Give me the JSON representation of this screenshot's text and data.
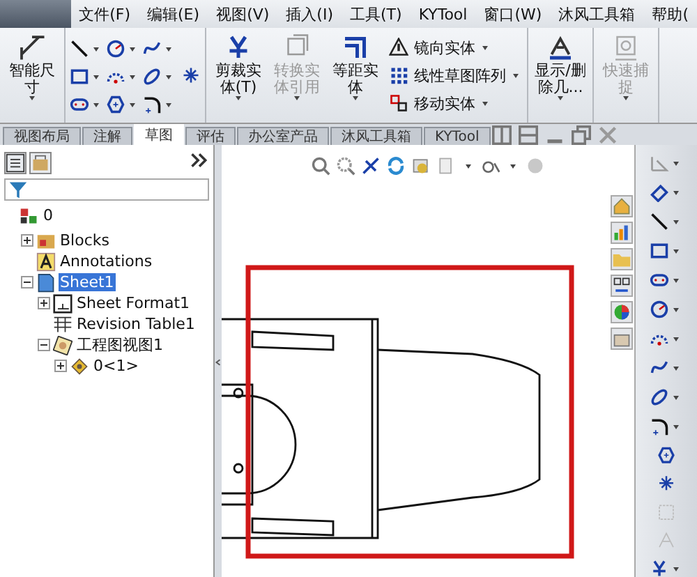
{
  "menu": [
    {
      "label": "文件(F)"
    },
    {
      "label": "编辑(E)"
    },
    {
      "label": "视图(V)"
    },
    {
      "label": "插入(I)"
    },
    {
      "label": "工具(T)"
    },
    {
      "label": "KYTool"
    },
    {
      "label": "窗口(W)"
    },
    {
      "label": "沐风工具箱"
    },
    {
      "label": "帮助("
    }
  ],
  "ribbon": {
    "smart_dimension": {
      "label": "智能尺寸"
    },
    "large_buttons": [
      {
        "label": "剪裁实体(T)",
        "disabled": false,
        "kind": "trim"
      },
      {
        "label": "转换实体引用",
        "disabled": true,
        "kind": "convert"
      },
      {
        "label": "等距实体",
        "disabled": false,
        "kind": "offset"
      }
    ],
    "small_buttons": [
      {
        "label": "镜向实体",
        "kind": "mirror"
      },
      {
        "label": "线性草图阵列",
        "kind": "pattern"
      },
      {
        "label": "移动实体",
        "kind": "move"
      }
    ],
    "end_buttons": [
      {
        "label": "显示/删除几...",
        "disabled": false,
        "kind": "relations"
      },
      {
        "label": "快速捕捉",
        "disabled": true,
        "kind": "snap"
      }
    ]
  },
  "tabs": [
    {
      "label": "视图布局",
      "selected": false
    },
    {
      "label": "注解",
      "selected": false
    },
    {
      "label": "草图",
      "selected": true
    },
    {
      "label": "评估",
      "selected": false
    },
    {
      "label": "办公室产品",
      "selected": false
    },
    {
      "label": "沐风工具箱",
      "selected": false
    },
    {
      "label": "KYTool",
      "selected": false
    }
  ],
  "tree": [
    {
      "label": "0",
      "kind": "part",
      "selected": false,
      "children": [
        {
          "label": "Blocks",
          "kind": "blocks",
          "selected": false,
          "expanded": false
        },
        {
          "label": "Annotations",
          "kind": "annotations",
          "selected": false
        },
        {
          "label": "Sheet1",
          "kind": "sheet",
          "selected": true,
          "expanded": true,
          "children": [
            {
              "label": "Sheet Format1",
              "kind": "sheet-format",
              "selected": false,
              "expanded": false
            },
            {
              "label": "Revision Table1",
              "kind": "table",
              "selected": false
            },
            {
              "label": "工程图视图1",
              "kind": "drawing-view",
              "selected": false,
              "expanded": true,
              "children": [
                {
                  "label": "0<1>",
                  "kind": "component",
                  "selected": false,
                  "expanded": false
                }
              ]
            }
          ]
        }
      ]
    }
  ]
}
